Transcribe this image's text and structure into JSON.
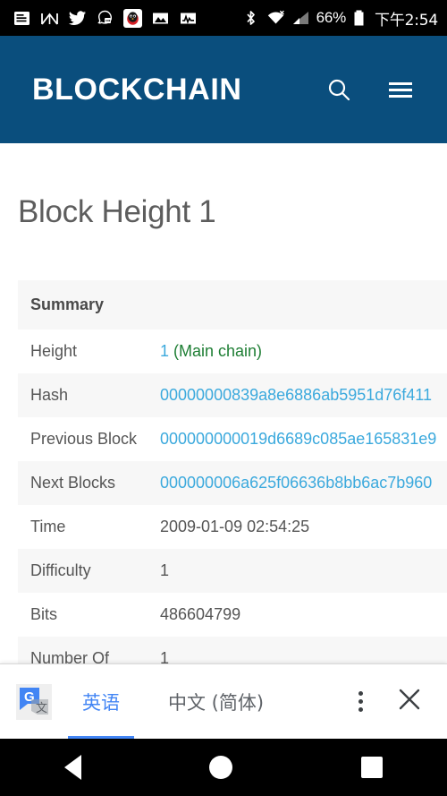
{
  "statusbar": {
    "icons": [
      "news-icon",
      "stock-chart-icon",
      "twitter-icon",
      "ghost-message-icon",
      "qq-penguin-icon",
      "photo-icon",
      "pulse-chart-icon"
    ],
    "bluetooth": "bluetooth-icon",
    "wifi": "wifi-off-icon",
    "signal": "cellular-signal-icon",
    "battery_percent": "66%",
    "battery": "battery-icon",
    "time": "下午2:54"
  },
  "appbar": {
    "brand": "BLOCKCHAIN",
    "search_icon": "search-icon",
    "menu_icon": "hamburger-menu-icon",
    "bg_color": "#0a4e7d"
  },
  "page": {
    "title": "Block Height 1"
  },
  "summary": {
    "header": "Summary",
    "rows": [
      {
        "label": "Height",
        "value": "1",
        "suffix": " (Main chain)",
        "type": "link-green"
      },
      {
        "label": "Hash",
        "value": "00000000839a8e6886ab5951d76f411",
        "suffix": "",
        "type": "link"
      },
      {
        "label": "Previous Block",
        "value": "000000000019d6689c085ae165831e9",
        "suffix": "",
        "type": "link"
      },
      {
        "label": "Next Blocks",
        "value": "000000006a625f06636b8bb6ac7b960",
        "suffix": "",
        "type": "link"
      },
      {
        "label": "Time",
        "value": "2009-01-09 02:54:25",
        "suffix": "",
        "type": "text"
      },
      {
        "label": "Difficulty",
        "value": "1",
        "suffix": "",
        "type": "text"
      },
      {
        "label": "Bits",
        "value": "486604799",
        "suffix": "",
        "type": "text"
      },
      {
        "label": "Number Of",
        "value": "1",
        "suffix": "",
        "type": "text"
      }
    ],
    "link_color": "#3ba9dd",
    "mainchain_color": "#1e7e34"
  },
  "translate_bar": {
    "logo": "google-translate-icon",
    "tab_source": "英语",
    "tab_target": "中文 (简体)",
    "more_icon": "overflow-menu-icon",
    "close_icon": "close-icon",
    "accent_color": "#4285f4"
  },
  "navbar": {
    "back": "back-triangle-icon",
    "home": "home-circle-icon",
    "recents": "recents-square-icon"
  }
}
